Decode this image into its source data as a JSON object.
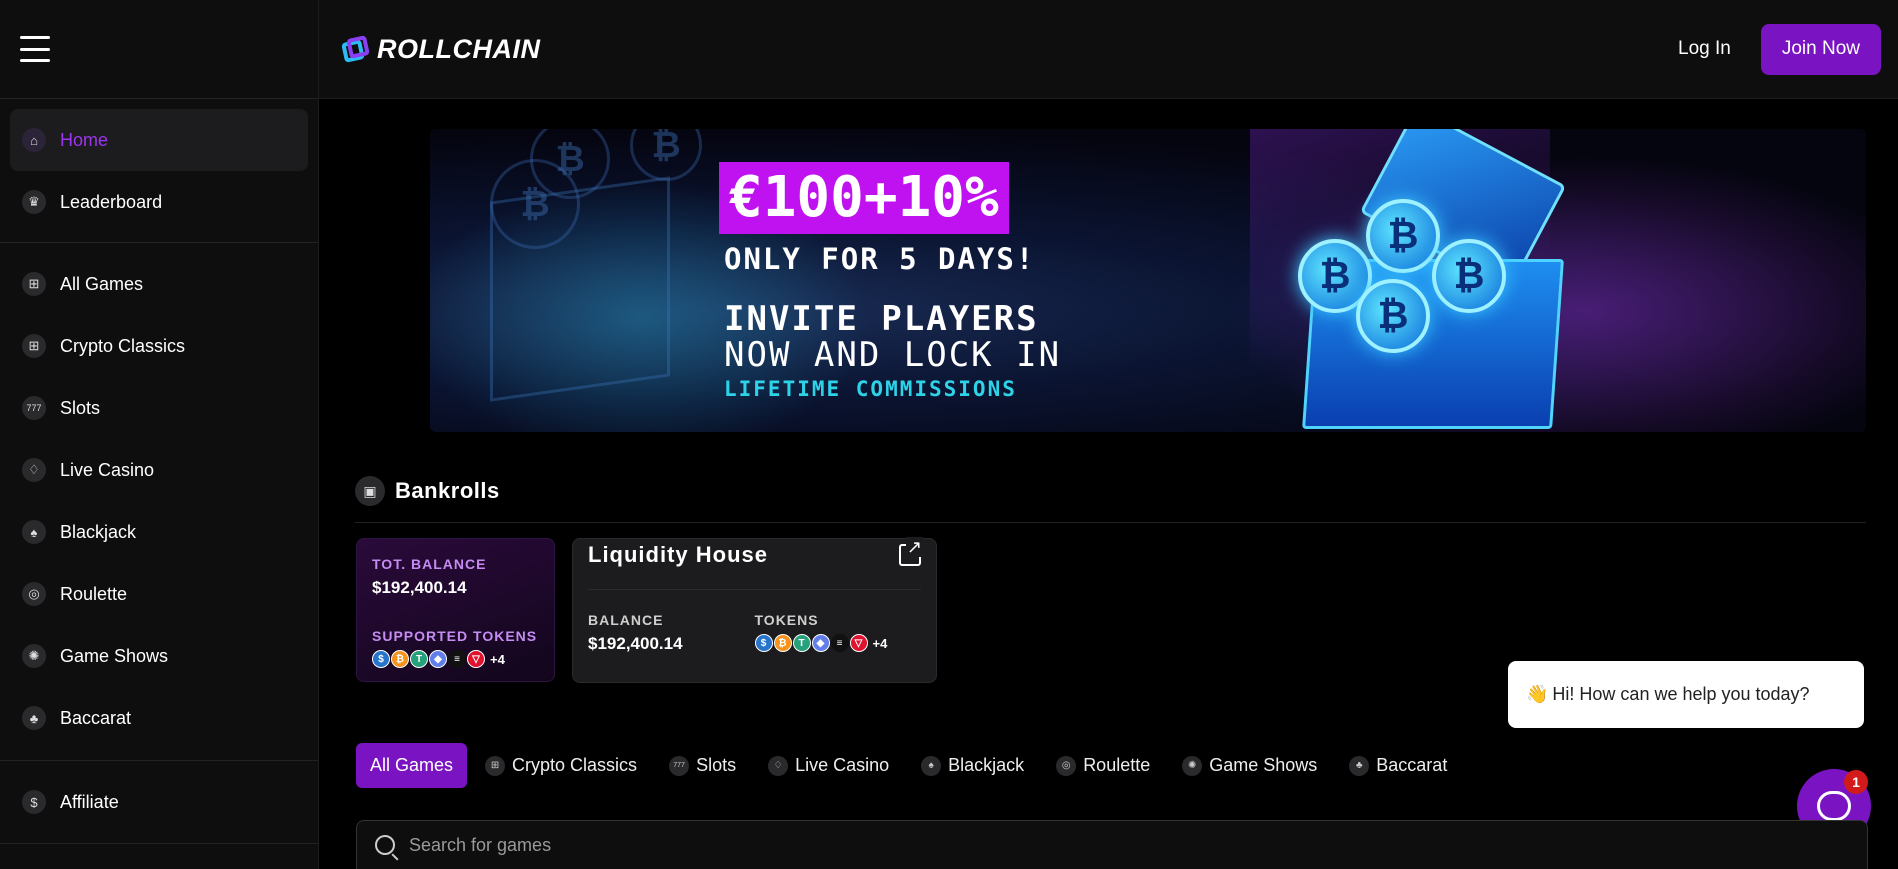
{
  "header": {
    "logo_text": "ROLLCHAIN",
    "login_label": "Log In",
    "join_label": "Join Now"
  },
  "sidebar": {
    "group1": [
      {
        "label": "Home",
        "icon": "home-icon",
        "glyph": "⌂"
      },
      {
        "label": "Leaderboard",
        "icon": "trophy-icon",
        "glyph": "♛"
      }
    ],
    "group2": [
      {
        "label": "All Games",
        "icon": "grid-icon",
        "glyph": "⊞"
      },
      {
        "label": "Crypto Classics",
        "icon": "grid-icon",
        "glyph": "⊞"
      },
      {
        "label": "Slots",
        "icon": "slots-icon",
        "glyph": "777"
      },
      {
        "label": "Live Casino",
        "icon": "diamond-icon",
        "glyph": "♢"
      },
      {
        "label": "Blackjack",
        "icon": "spade-icon",
        "glyph": "♠"
      },
      {
        "label": "Roulette",
        "icon": "roulette-icon",
        "glyph": "◎"
      },
      {
        "label": "Game Shows",
        "icon": "wheel-icon",
        "glyph": "✺"
      },
      {
        "label": "Baccarat",
        "icon": "cards-icon",
        "glyph": "♣"
      }
    ],
    "group3": [
      {
        "label": "Affiliate",
        "icon": "coins-icon",
        "glyph": "$"
      }
    ]
  },
  "banner": {
    "headline": "€100+10%",
    "line1": "ONLY FOR 5 DAYS!",
    "line2": "INVITE PLAYERS",
    "line3": "NOW AND LOCK IN",
    "line4": "LIFETIME COMMISSIONS"
  },
  "bankrolls": {
    "title": "Bankrolls",
    "total_card": {
      "balance_label": "TOT. BALANCE",
      "balance_value": "$192,400.14",
      "tokens_label": "SUPPORTED TOKENS",
      "tokens_more": "+4"
    },
    "house_card": {
      "name": "Liquidity House",
      "balance_label": "BALANCE",
      "balance_value": "$192,400.14",
      "tokens_label": "TOKENS",
      "tokens_more": "+4"
    },
    "tokens": [
      {
        "name": "usdc",
        "color": "#2775ca",
        "glyph": "$"
      },
      {
        "name": "bitcoin",
        "color": "#f7931a",
        "glyph": "₿"
      },
      {
        "name": "tether",
        "color": "#26a17b",
        "glyph": "T"
      },
      {
        "name": "ethereum",
        "color": "#627eea",
        "glyph": "◆"
      },
      {
        "name": "solana",
        "color": "#111111",
        "glyph": "≡"
      },
      {
        "name": "tron",
        "color": "#e0132e",
        "glyph": "▽"
      }
    ]
  },
  "tabs": [
    {
      "label": "All Games",
      "glyph": ""
    },
    {
      "label": "Crypto Classics",
      "glyph": "⊞"
    },
    {
      "label": "Slots",
      "glyph": "777"
    },
    {
      "label": "Live Casino",
      "glyph": "♢"
    },
    {
      "label": "Blackjack",
      "glyph": "♠"
    },
    {
      "label": "Roulette",
      "glyph": "◎"
    },
    {
      "label": "Game Shows",
      "glyph": "✺"
    },
    {
      "label": "Baccarat",
      "glyph": "♣"
    }
  ],
  "search": {
    "placeholder": "Search for games"
  },
  "chat": {
    "message": "Hi! How can we help you today?",
    "badge": "1"
  },
  "colors": {
    "accent": "#7a14c2",
    "active_text": "#9d35f0",
    "promo": "#c012f0",
    "commission": "#2ed3e8"
  }
}
